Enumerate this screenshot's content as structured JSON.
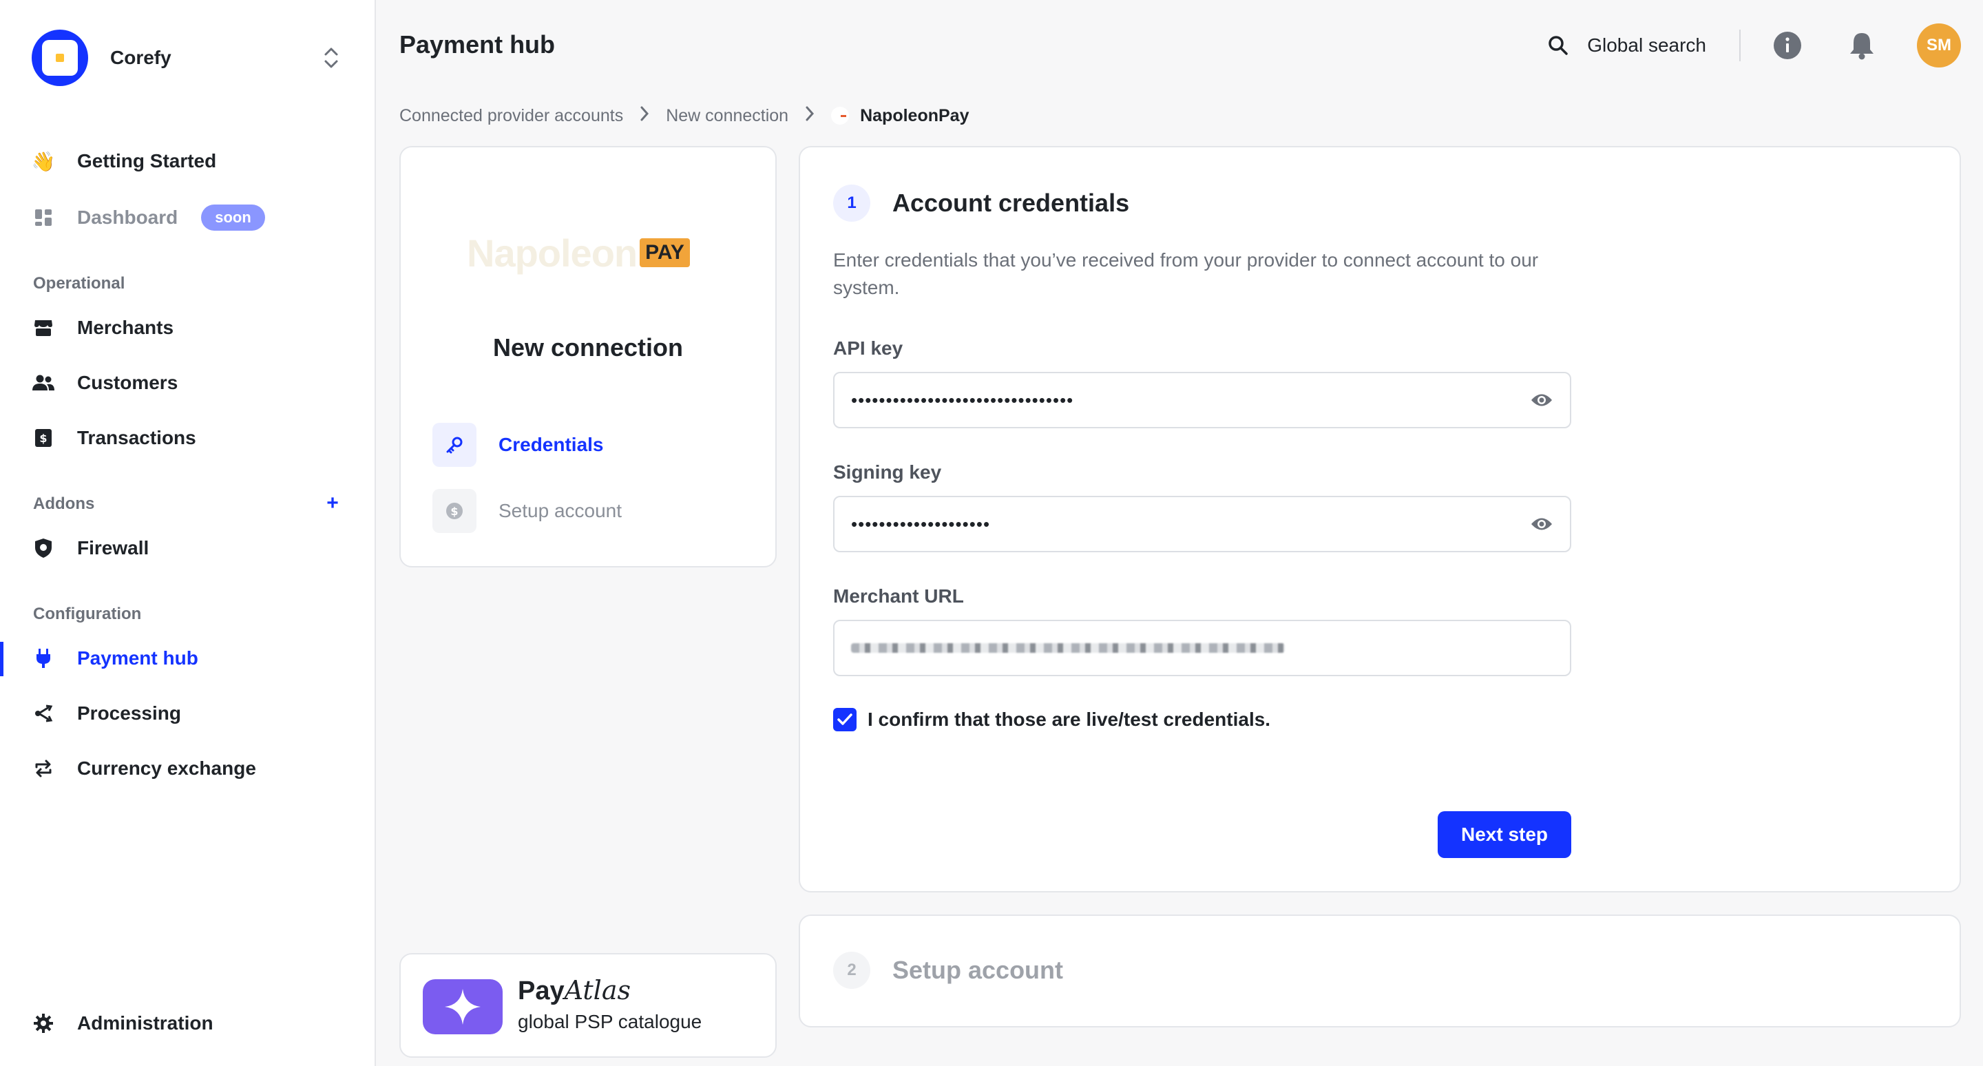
{
  "app": {
    "brand_name": "Corefy",
    "page_title": "Payment hub"
  },
  "sidebar": {
    "getting_started": "Getting Started",
    "dashboard": "Dashboard",
    "dashboard_badge": "soon",
    "sections": {
      "operational": "Operational",
      "addons": "Addons",
      "configuration": "Configuration"
    },
    "operational_items": [
      "Merchants",
      "Customers",
      "Transactions"
    ],
    "addons_items": [
      "Firewall"
    ],
    "configuration_items": [
      "Payment hub",
      "Processing",
      "Currency exchange"
    ],
    "administration": "Administration",
    "active_item": "Payment hub"
  },
  "topbar": {
    "search_label": "Global search",
    "avatar_initials": "SM"
  },
  "breadcrumb": {
    "items": [
      "Connected provider accounts",
      "New connection",
      "NapoleonPay"
    ]
  },
  "left_panel": {
    "provider_logo_word": "Napoleon",
    "provider_logo_badge": "PAY",
    "title": "New connection",
    "steps": [
      {
        "label": "Credentials",
        "state": "active"
      },
      {
        "label": "Setup account",
        "state": "inactive"
      }
    ]
  },
  "payatlas": {
    "name_bold": "Pay",
    "name_italic": "Atlas",
    "subtitle": "global PSP catalogue"
  },
  "step1": {
    "number": "1",
    "title": "Account credentials",
    "description": "Enter credentials that you’ve received from your provider to connect account to our system.",
    "api_key_label": "API key",
    "api_key_value": "••••••••••••••••••••••••••••••••",
    "signing_key_label": "Signing key",
    "signing_key_value": "••••••••••••••••••••",
    "merchant_url_label": "Merchant URL",
    "confirm_label": "I confirm that those are live/test credentials.",
    "confirm_checked": true,
    "next_button": "Next step"
  },
  "step2": {
    "number": "2",
    "title": "Setup account"
  },
  "colors": {
    "accent": "#1433ff",
    "avatar": "#eea73a",
    "badge": "#8a96ff",
    "payatlas": "#7b5cf0"
  }
}
